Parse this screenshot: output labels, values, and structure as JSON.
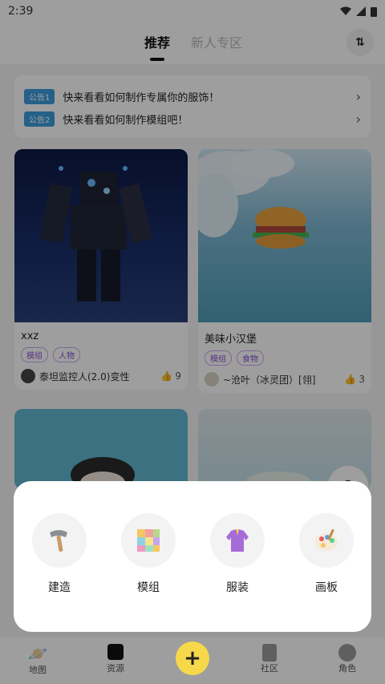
{
  "status": {
    "time": "2:39"
  },
  "tabs": [
    {
      "label": "推荐"
    },
    {
      "label": "新人专区"
    }
  ],
  "announcements": [
    {
      "badge": "公告1",
      "text": "快来看看如何制作专属你的服饰！"
    },
    {
      "badge": "公告2",
      "text": "快来看看如何制作模组吧！"
    }
  ],
  "cards": [
    {
      "title": "xxz",
      "tags": [
        "模组",
        "人物"
      ],
      "author": "泰坦监控人(2.0)变性",
      "likes": "9"
    },
    {
      "title": "美味小汉堡",
      "tags": [
        "模组",
        "食物"
      ],
      "author": "~沧叶（冰灵团）[翎]",
      "likes": "3"
    }
  ],
  "create_menu": [
    {
      "label": "建造",
      "icon": "hammer-icon"
    },
    {
      "label": "模组",
      "icon": "cube-icon"
    },
    {
      "label": "服装",
      "icon": "jacket-icon"
    },
    {
      "label": "画板",
      "icon": "palette-icon"
    }
  ],
  "bottom_nav": [
    {
      "label": "地图",
      "icon": "planet-icon"
    },
    {
      "label": "资源",
      "icon": "resource-icon"
    },
    {
      "label": "社区",
      "icon": "community-icon"
    },
    {
      "label": "角色",
      "icon": "avatar-icon"
    }
  ],
  "colors": {
    "accent_yellow": "#f6d84a",
    "badge_blue": "#3d9bdc",
    "tag_purple": "#8a52d6"
  }
}
